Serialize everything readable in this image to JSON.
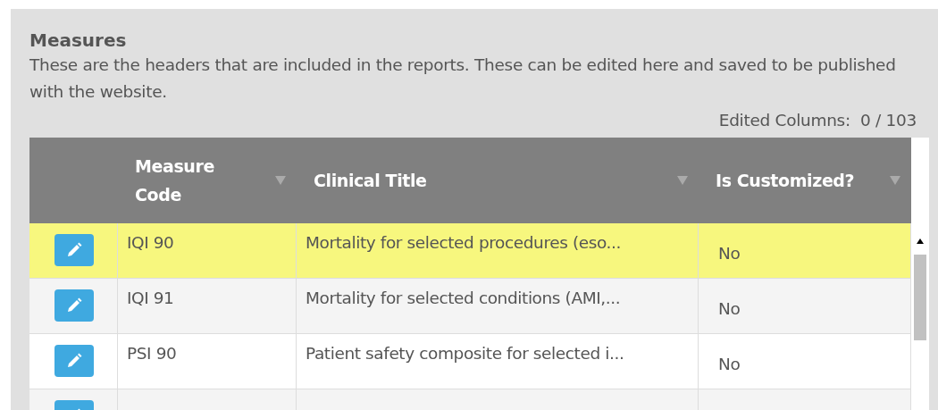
{
  "panel": {
    "title": "Measures",
    "description": "These are the headers that are included in the reports.  These can be edited here and saved to be published with the website.",
    "edited_label": "Edited Columns:",
    "edited_count": "0 / 103"
  },
  "table": {
    "columns": [
      "Measure Code",
      "Clinical Title",
      "Is Customized?"
    ],
    "rows": [
      {
        "code": "IQI 90",
        "title": "Mortality for selected procedures (eso...",
        "customized": "No",
        "selected": true
      },
      {
        "code": "IQI 91",
        "title": "Mortality for selected conditions (AMI,...",
        "customized": "No",
        "selected": false
      },
      {
        "code": "PSI 90",
        "title": "Patient safety composite for selected i...",
        "customized": "No",
        "selected": false
      }
    ]
  }
}
